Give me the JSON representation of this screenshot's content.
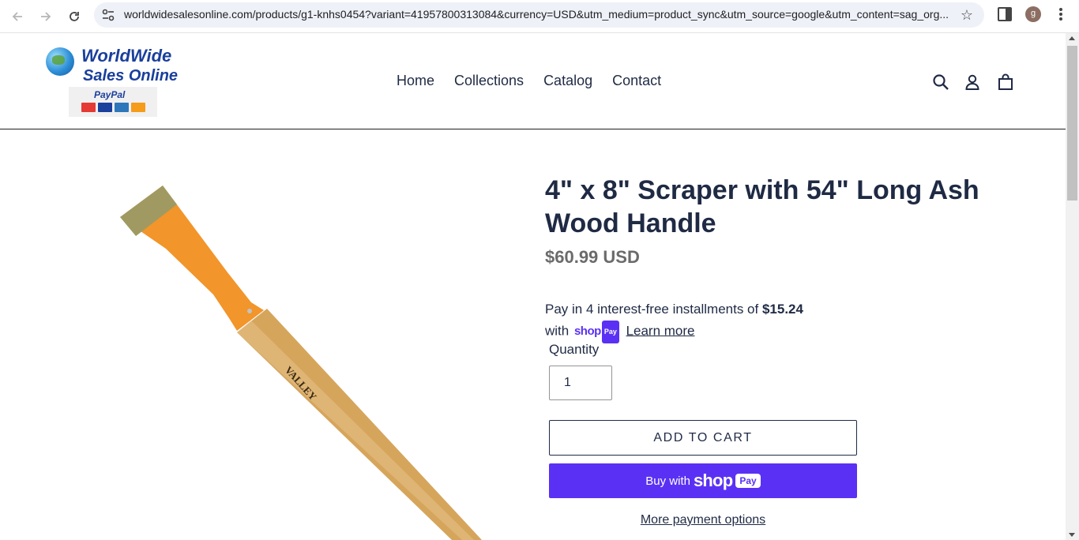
{
  "browser": {
    "url": "worldwidesalesonline.com/products/g1-knhs0454?variant=41957800313084&currency=USD&utm_medium=product_sync&utm_source=google&utm_content=sag_org...",
    "profile_initial": "g"
  },
  "site": {
    "logo": {
      "line1": "WorldWide",
      "line2": "Sales Online",
      "paypal": "PayPal"
    },
    "nav": [
      "Home",
      "Collections",
      "Catalog",
      "Contact"
    ]
  },
  "product": {
    "title": "4\" x 8\" Scraper with 54\" Long Ash Wood Handle",
    "price": "$60.99 USD",
    "installments_prefix": "Pay in 4 interest-free installments of",
    "installment_amount": "$15.24",
    "installments_with": "with",
    "shop_word": "shop",
    "pay_word": "Pay",
    "learn_more": "Learn more",
    "handle_brand": "VALLEY",
    "quantity_label": "Quantity",
    "quantity_value": "1",
    "add_to_cart": "ADD TO CART",
    "buy_with": "Buy with",
    "more_payment_options": "More payment options"
  },
  "colors": {
    "shop_purple": "#5a31f4",
    "text_navy": "#1f2a44",
    "price_gray": "#6b6b6b",
    "blade_orange": "#f2952a",
    "blade_edge": "#a09a62"
  },
  "icons": [
    "back-arrow-icon",
    "forward-arrow-icon",
    "reload-icon",
    "site-settings-icon",
    "star-icon",
    "side-panel-icon",
    "kebab-menu-icon",
    "search-icon",
    "account-icon",
    "cart-icon"
  ]
}
